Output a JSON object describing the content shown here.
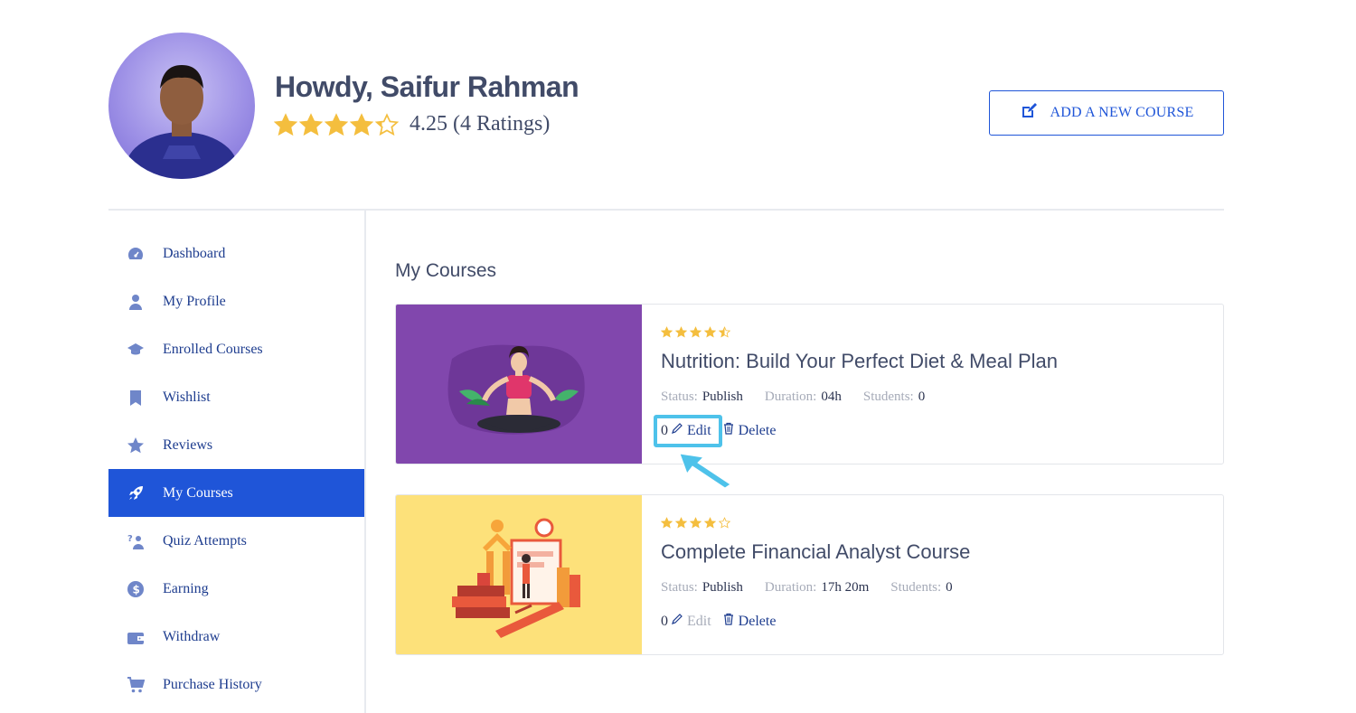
{
  "header": {
    "greeting": "Howdy,",
    "name": "Saifur Rahman",
    "rating_text": "4.25 (4 Ratings)",
    "add_course_label": "ADD A NEW COURSE"
  },
  "sidebar": {
    "items": [
      {
        "label": "Dashboard",
        "icon": "dashboard-icon"
      },
      {
        "label": "My Profile",
        "icon": "user-icon"
      },
      {
        "label": "Enrolled Courses",
        "icon": "graduation-cap-icon"
      },
      {
        "label": "Wishlist",
        "icon": "bookmark-icon"
      },
      {
        "label": "Reviews",
        "icon": "star-icon"
      },
      {
        "label": "My Courses",
        "icon": "rocket-icon",
        "active": true
      },
      {
        "label": "Quiz Attempts",
        "icon": "quiz-icon"
      },
      {
        "label": "Earning",
        "icon": "dollar-icon"
      },
      {
        "label": "Withdraw",
        "icon": "wallet-icon"
      },
      {
        "label": "Purchase History",
        "icon": "cart-icon"
      }
    ]
  },
  "main": {
    "title": "My Courses",
    "courses": [
      {
        "title": "Nutrition: Build Your Perfect Diet & Meal Plan",
        "rating": 4.5,
        "status_label": "Status:",
        "status": "Publish",
        "duration_label": "Duration:",
        "duration": "04h",
        "students_label": "Students:",
        "students": "0",
        "count": "0",
        "edit_label": "Edit",
        "delete_label": "Delete"
      },
      {
        "title": "Complete Financial Analyst Course",
        "rating": 4,
        "status_label": "Status:",
        "status": "Publish",
        "duration_label": "Duration:",
        "duration": "17h 20m",
        "students_label": "Students:",
        "students": "0",
        "count": "0",
        "edit_label": "Edit",
        "delete_label": "Delete"
      }
    ]
  },
  "colors": {
    "accent": "#1f55d8",
    "star": "#f4be3e",
    "thumb_purple": "#8147ad",
    "thumb_yellow": "#fde17a"
  }
}
